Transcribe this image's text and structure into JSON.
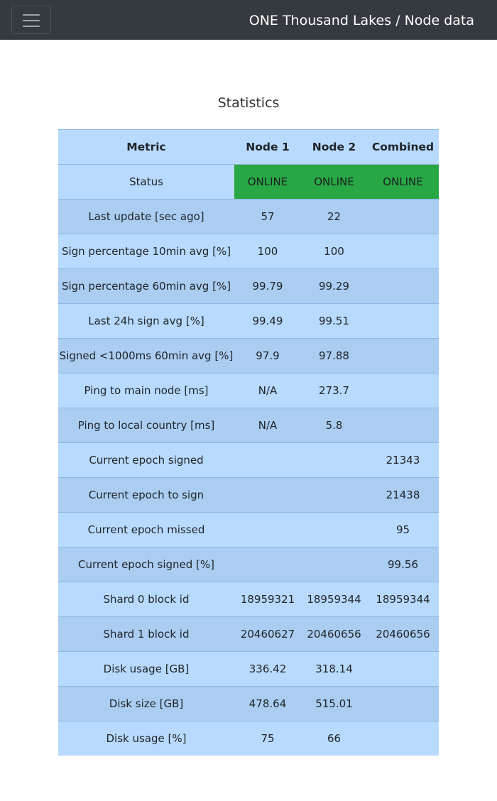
{
  "navbar": {
    "brand": "ONE Thousand Lakes / Node data",
    "toggle_icon": "hamburger-menu-icon"
  },
  "heading": "Statistics",
  "table": {
    "headers": [
      "Metric",
      "Node 1",
      "Node 2",
      "Combined"
    ],
    "rows": [
      [
        "Status",
        "ONLINE",
        "ONLINE",
        "ONLINE"
      ],
      [
        "Last update [sec ago]",
        "57",
        "22",
        ""
      ],
      [
        "Sign percentage 10min avg [%]",
        "100",
        "100",
        ""
      ],
      [
        "Sign percentage 60min avg [%]",
        "99.79",
        "99.29",
        ""
      ],
      [
        "Last 24h sign avg [%]",
        "99.49",
        "99.51",
        ""
      ],
      [
        "Signed <1000ms 60min avg [%]",
        "97.9",
        "97.88",
        ""
      ],
      [
        "Ping to main node [ms]",
        "N/A",
        "273.7",
        ""
      ],
      [
        "Ping to local country [ms]",
        "N/A",
        "5.8",
        ""
      ],
      [
        "Current epoch signed",
        "",
        "",
        "21343"
      ],
      [
        "Current epoch to sign",
        "",
        "",
        "21438"
      ],
      [
        "Current epoch missed",
        "",
        "",
        "95"
      ],
      [
        "Current epoch signed [%]",
        "",
        "",
        "99.56"
      ],
      [
        "Shard 0 block id",
        "18959321",
        "18959344",
        "18959344"
      ],
      [
        "Shard 1 block id",
        "20460627",
        "20460656",
        "20460656"
      ],
      [
        "Disk usage [GB]",
        "336.42",
        "318.14",
        ""
      ],
      [
        "Disk size [GB]",
        "478.64",
        "515.01",
        ""
      ],
      [
        "Disk usage [%]",
        "75",
        "66",
        ""
      ]
    ]
  },
  "colors": {
    "navbar_bg": "#343a40",
    "row_light": "#b8daff",
    "row_dark": "#abcdf2",
    "online": "#28a745"
  }
}
